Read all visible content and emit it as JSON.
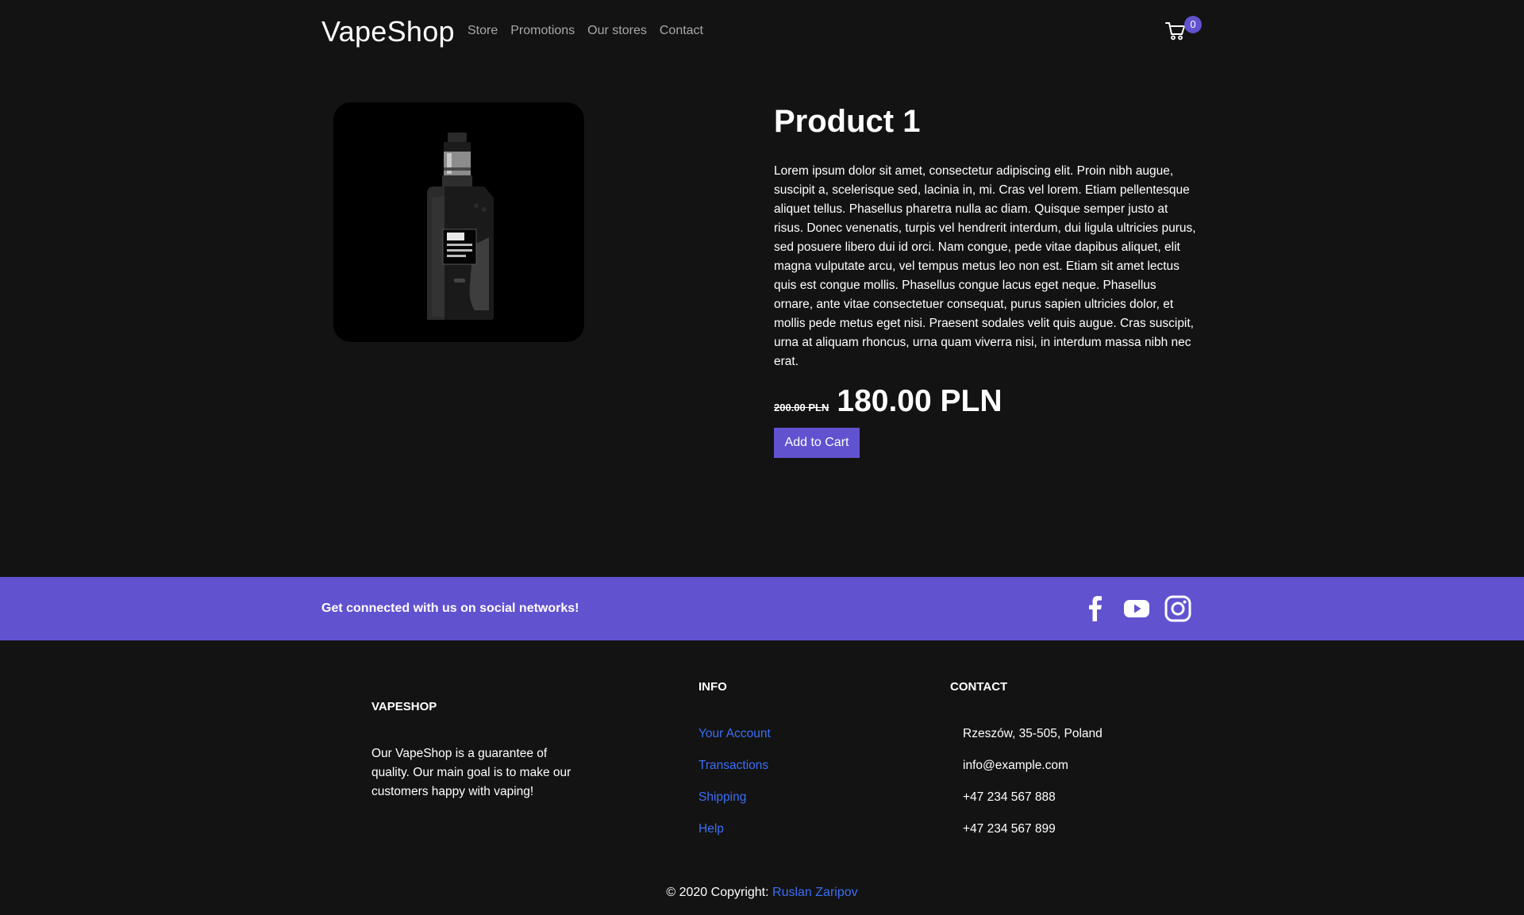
{
  "navbar": {
    "brand": "VapeShop",
    "links": [
      "Store",
      "Promotions",
      "Our stores",
      "Contact"
    ],
    "cart_count": "0",
    "cart_icon": "cart-icon"
  },
  "product": {
    "title": "Product 1",
    "description": "Lorem ipsum dolor sit amet, consectetur adipiscing elit. Proin nibh augue, suscipit a, scelerisque sed, lacinia in, mi. Cras vel lorem. Etiam pellentesque aliquet tellus. Phasellus pharetra nulla ac diam. Quisque semper justo at risus. Donec venenatis, turpis vel hendrerit interdum, dui ligula ultricies purus, sed posuere libero dui id orci. Nam congue, pede vitae dapibus aliquet, elit magna vulputate arcu, vel tempus metus leo non est. Etiam sit amet lectus quis est congue mollis. Phasellus congue lacus eget neque. Phasellus ornare, ante vitae consectetuer consequat, purus sapien ultricies dolor, et mollis pede metus eget nisi. Praesent sodales velit quis augue. Cras suscipit, urna at aliquam rhoncus, urna quam viverra nisi, in interdum massa nibh nec erat.",
    "old_price": "200.00 PLN",
    "price": "180.00 PLN",
    "add_to_cart_label": "Add to Cart"
  },
  "social": {
    "text": "Get connected with us on social networks!",
    "icons": [
      "facebook-icon",
      "youtube-icon",
      "instagram-icon"
    ]
  },
  "footer": {
    "about": {
      "title": "VAPESHOP",
      "text": "Our VapeShop is a guarantee of quality. Our main goal is to make our customers happy with vaping!"
    },
    "info": {
      "title": "INFO",
      "links": [
        "Your Account",
        "Transactions",
        "Shipping",
        "Help"
      ]
    },
    "contact": {
      "title": "CONTACT",
      "items": [
        "Rzeszów, 35-505, Poland",
        "info@example.com",
        "+47 234 567 888",
        "+47 234 567 899"
      ]
    },
    "copyright_prefix": "© 2020 Copyright: ",
    "copyright_author": "Ruslan Zaripov"
  },
  "colors": {
    "background": "#131313",
    "accent": "#6152d0",
    "link": "#3b6ef5"
  }
}
